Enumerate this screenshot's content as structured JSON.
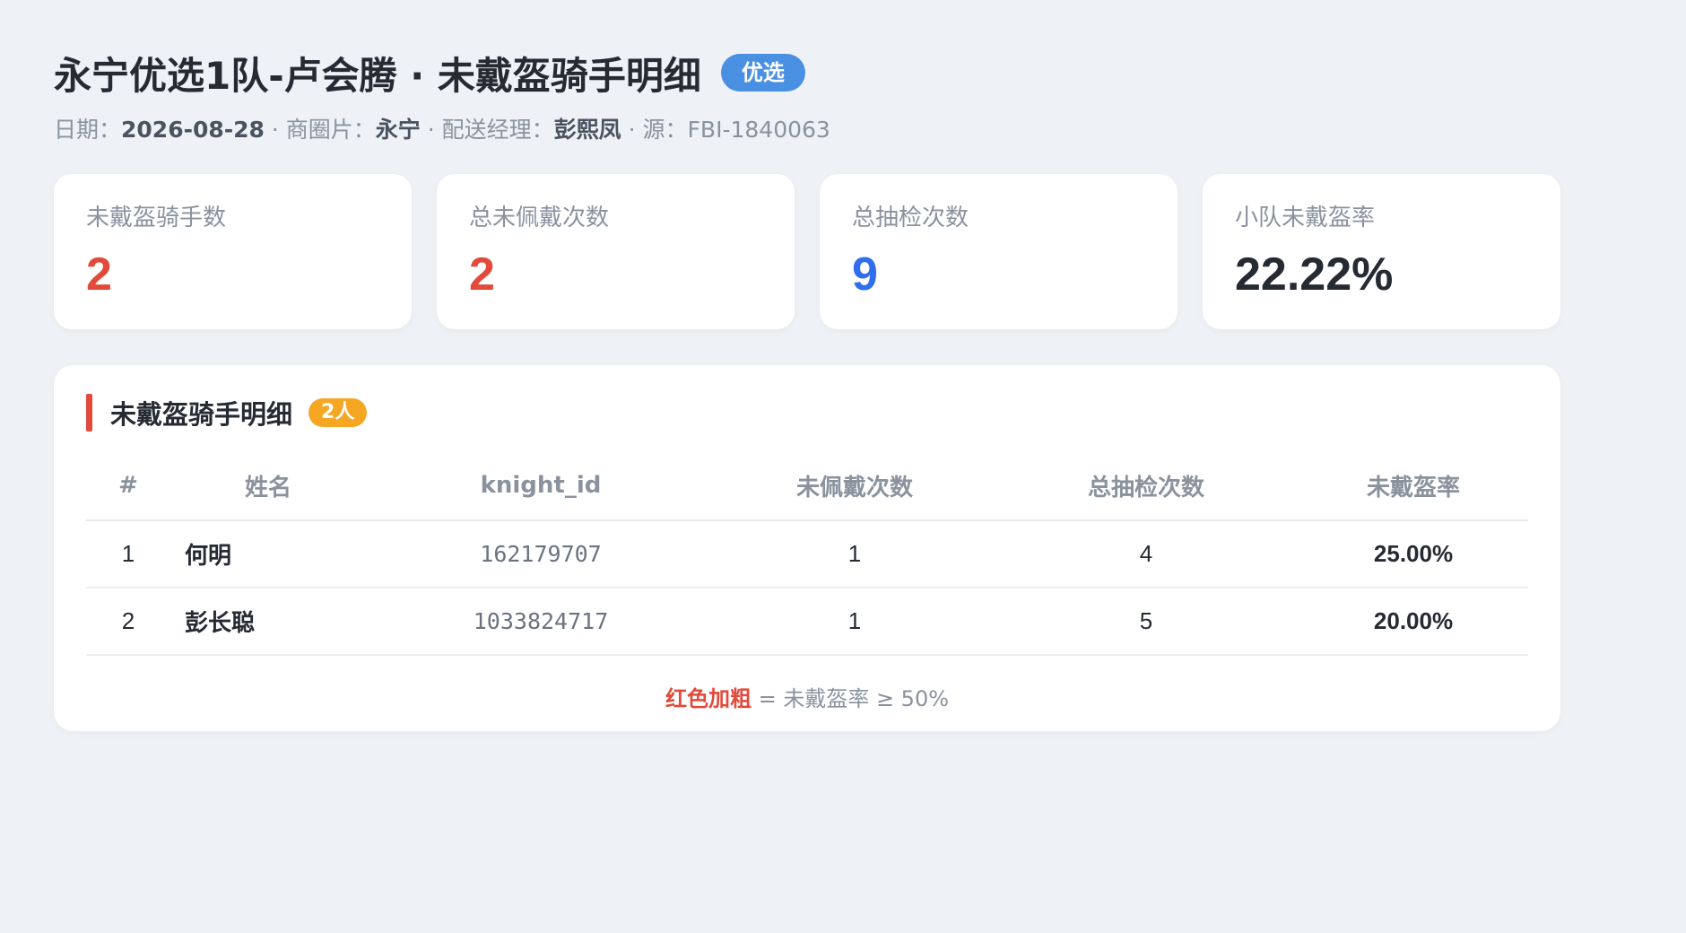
{
  "header": {
    "title": "永宁优选1队-卢会腾 · 未戴盔骑手明细",
    "badge": "优选",
    "meta": {
      "date_label": "日期：",
      "date": "2026-08-28",
      "sep1": " · ",
      "zone_label": "商圈片：",
      "zone": "永宁",
      "sep2": " · ",
      "manager_label": "配送经理：",
      "manager": "彭熙凤",
      "sep3": " · ",
      "source_label": "源：",
      "source": "FBI-1840063"
    }
  },
  "cards": [
    {
      "label": "未戴盔骑手数",
      "value": "2",
      "color": "#e24a3b"
    },
    {
      "label": "总未佩戴次数",
      "value": "2",
      "color": "#e24a3b"
    },
    {
      "label": "总抽检次数",
      "value": "9",
      "color": "#2f6fed"
    },
    {
      "label": "小队未戴盔率",
      "value": "22.22%",
      "color": "#252a33"
    }
  ],
  "panel": {
    "title": "未戴盔骑手明细",
    "count_badge": "2人",
    "columns": [
      "#",
      "姓名",
      "knight_id",
      "未佩戴次数",
      "总抽检次数",
      "未戴盔率"
    ],
    "rows": [
      {
        "index": "1",
        "name": "何明",
        "knight_id": "162179707",
        "no_helmet": "1",
        "total_checks": "4",
        "rate": "25.00%"
      },
      {
        "index": "2",
        "name": "彭长聪",
        "knight_id": "1033824717",
        "no_helmet": "1",
        "total_checks": "5",
        "rate": "20.00%"
      }
    ],
    "legend_highlight": "红色加粗",
    "legend_text": " = 未戴盔率 ≥ 50%"
  },
  "colors": {
    "accent_red": "#e24a3b",
    "accent_blue": "#2f6fed",
    "badge_blue": "#4a90e2",
    "badge_orange": "#f5a623",
    "background": "#eef1f5"
  }
}
